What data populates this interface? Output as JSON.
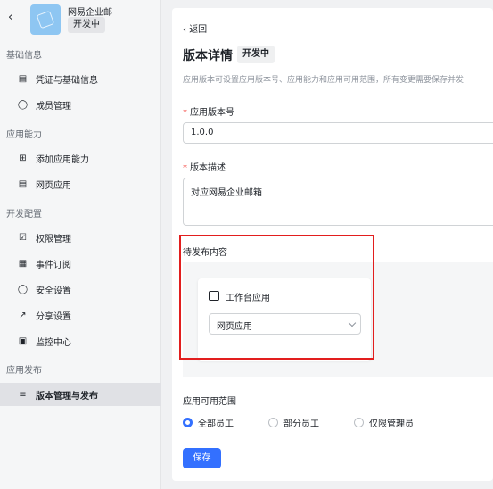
{
  "app": {
    "name": "网易企业邮",
    "status_badge": "开发中"
  },
  "sidebar": {
    "sections": [
      {
        "title": "基础信息"
      },
      {
        "title": "应用能力"
      },
      {
        "title": "开发配置"
      },
      {
        "title": "应用发布"
      }
    ],
    "items": [
      {
        "label": "凭证与基础信息",
        "icon": "credential-icon"
      },
      {
        "label": "成员管理",
        "icon": "member-icon"
      },
      {
        "label": "添加应用能力",
        "icon": "grid-add-icon"
      },
      {
        "label": "网页应用",
        "icon": "webpage-icon"
      },
      {
        "label": "权限管理",
        "icon": "permission-icon"
      },
      {
        "label": "事件订阅",
        "icon": "event-icon"
      },
      {
        "label": "安全设置",
        "icon": "shield-icon"
      },
      {
        "label": "分享设置",
        "icon": "share-icon"
      },
      {
        "label": "监控中心",
        "icon": "monitor-icon"
      },
      {
        "label": "版本管理与发布",
        "icon": "layers-icon",
        "active": true
      }
    ]
  },
  "main": {
    "back_label": "返回",
    "title": "版本详情",
    "title_badge": "开发中",
    "description": "应用版本可设置应用版本号、应用能力和应用可用范围，所有变更需要保存并发",
    "version_label": "应用版本号",
    "version_value": "1.0.0",
    "desc_label": "版本描述",
    "desc_value": "对应网易企业邮箱",
    "pending_title": "待发布内容",
    "card_title": "工作台应用",
    "card_select_value": "网页应用",
    "scope_title": "应用可用范围",
    "scope_options": [
      {
        "label": "全部员工",
        "checked": true
      },
      {
        "label": "部分员工",
        "checked": false
      },
      {
        "label": "仅限管理员",
        "checked": false
      }
    ],
    "save_label": "保存"
  },
  "colors": {
    "primary": "#3370ff",
    "highlight_box": "#e21e1e",
    "required": "#f54a45"
  }
}
